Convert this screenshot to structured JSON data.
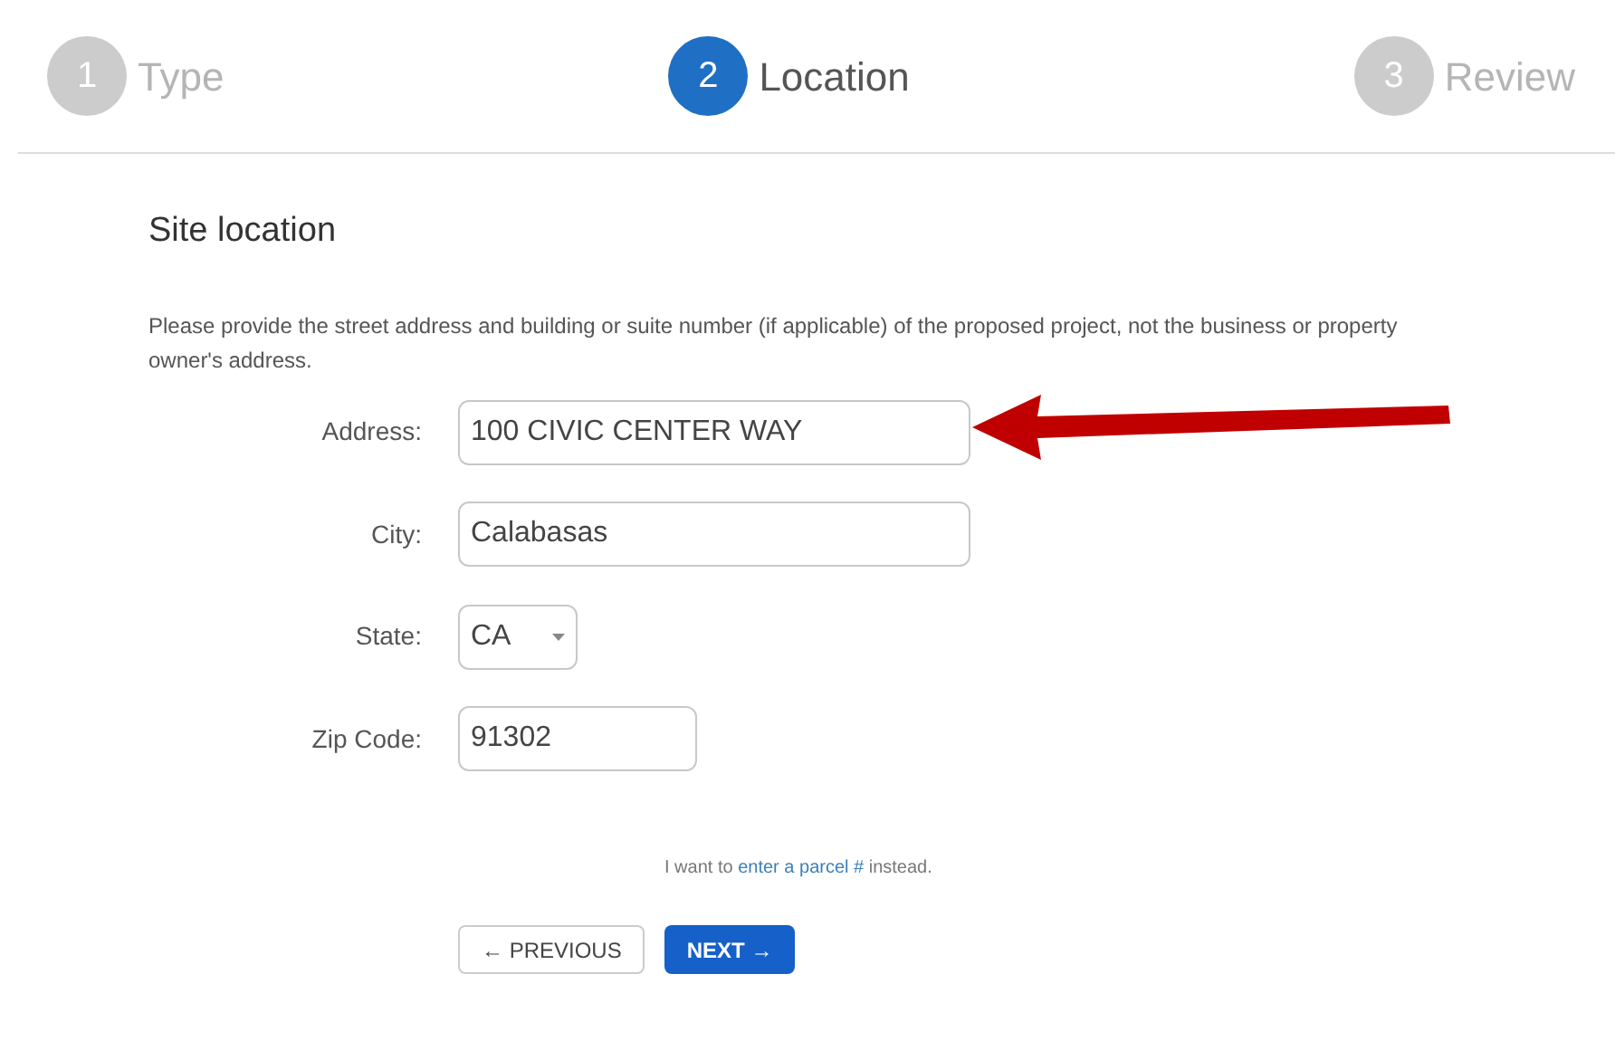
{
  "steps": [
    {
      "number": "1",
      "label": "Type",
      "selected": false
    },
    {
      "number": "2",
      "label": "Location",
      "selected": true
    },
    {
      "number": "3",
      "label": "Review",
      "selected": false
    }
  ],
  "section": {
    "title": "Site location",
    "description": "Please provide the street address and building or suite number (if applicable) of the proposed project, not the business or property owner's address."
  },
  "fields": [
    {
      "kind": "text",
      "label": "Address:",
      "value": "100 CIVIC CENTER WAY"
    },
    {
      "kind": "text",
      "label": "City:",
      "value": "Calabasas"
    },
    {
      "kind": "select",
      "label": "State:",
      "value": "CA"
    },
    {
      "kind": "short",
      "label": "Zip Code:",
      "value": "91302"
    }
  ],
  "parcel_note": {
    "before": "I want to",
    "link": "enter a parcel #",
    "after": "instead."
  },
  "buttons": [
    {
      "kind": "secondary",
      "label": "← PREVIOUS"
    },
    {
      "kind": "primary",
      "label": "NEXT →"
    }
  ]
}
